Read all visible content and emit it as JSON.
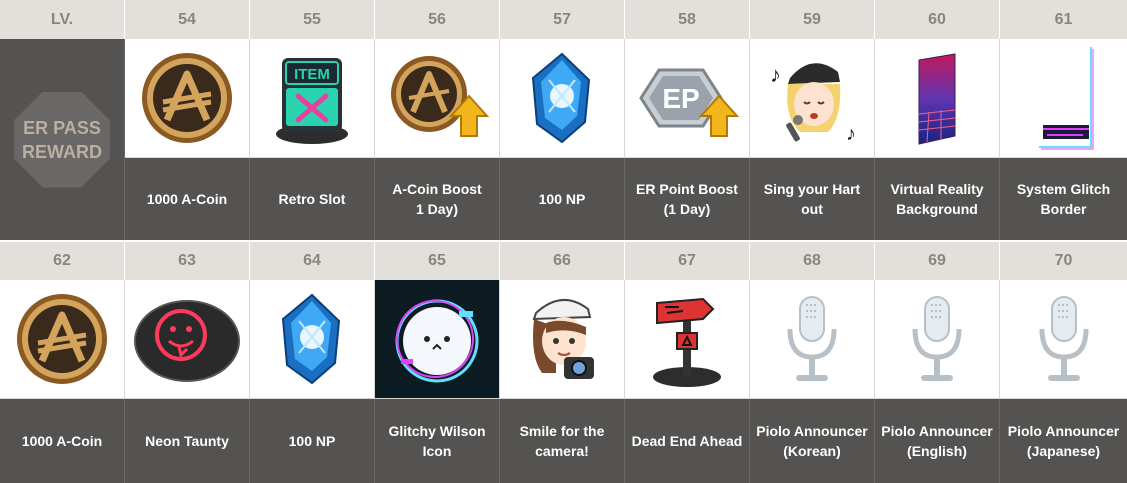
{
  "header": {
    "lv_label": "LV."
  },
  "side": {
    "title_line1": "ER PASS",
    "title_line2": "REWARD"
  },
  "row1": [
    {
      "level": "54",
      "name_line1": "1000 A-Coin",
      "name_line2": "",
      "icon": "a-coin-icon"
    },
    {
      "level": "55",
      "name_line1": "Retro Slot",
      "name_line2": "",
      "icon": "retro-slot-icon",
      "icon_text": "ITEM"
    },
    {
      "level": "56",
      "name_line1": "A-Coin Boost",
      "name_line2": "1 Day)",
      "icon": "a-coin-boost-icon"
    },
    {
      "level": "57",
      "name_line1": "100 NP",
      "name_line2": "",
      "icon": "np-crystal-icon"
    },
    {
      "level": "58",
      "name_line1": "ER Point Boost",
      "name_line2": "(1 Day)",
      "icon": "er-point-boost-icon",
      "icon_text": "EP"
    },
    {
      "level": "59",
      "name_line1": "Sing your Hart",
      "name_line2": "out",
      "icon": "singing-emote-icon"
    },
    {
      "level": "60",
      "name_line1": "Virtual Reality",
      "name_line2": "Background",
      "icon": "vr-background-icon"
    },
    {
      "level": "61",
      "name_line1": "System Glitch",
      "name_line2": "Border",
      "icon": "glitch-border-icon"
    }
  ],
  "row2": [
    {
      "level": "62",
      "name_line1": "1000 A-Coin",
      "name_line2": "",
      "icon": "a-coin-icon"
    },
    {
      "level": "63",
      "name_line1": "Neon Taunty",
      "name_line2": "",
      "icon": "neon-taunty-icon"
    },
    {
      "level": "64",
      "name_line1": "100 NP",
      "name_line2": "",
      "icon": "np-crystal-icon"
    },
    {
      "level": "65",
      "name_line1": "Glitchy Wilson",
      "name_line2": "Icon",
      "icon": "glitchy-wilson-icon"
    },
    {
      "level": "66",
      "name_line1": "Smile for the",
      "name_line2": "camera!",
      "icon": "camera-emote-icon"
    },
    {
      "level": "67",
      "name_line1": "Dead End Ahead",
      "name_line2": "",
      "icon": "dead-end-sign-icon"
    },
    {
      "level": "68",
      "name_line1": "Piolo Announcer",
      "name_line2": "(Korean)",
      "icon": "microphone-icon"
    },
    {
      "level": "69",
      "name_line1": "Piolo Announcer",
      "name_line2": "(English)",
      "icon": "microphone-icon"
    },
    {
      "level": "70",
      "name_line1": "Piolo Announcer",
      "name_line2": "(Japanese)",
      "icon": "microphone-icon"
    }
  ],
  "colors": {
    "header_bg": "#e3e0dc",
    "header_text": "#8a857f",
    "name_bg": "#545351",
    "coin_gold": "#c9a15a",
    "crystal_blue": "#3fa9f5",
    "boost_arrow": "#f2b51c"
  }
}
